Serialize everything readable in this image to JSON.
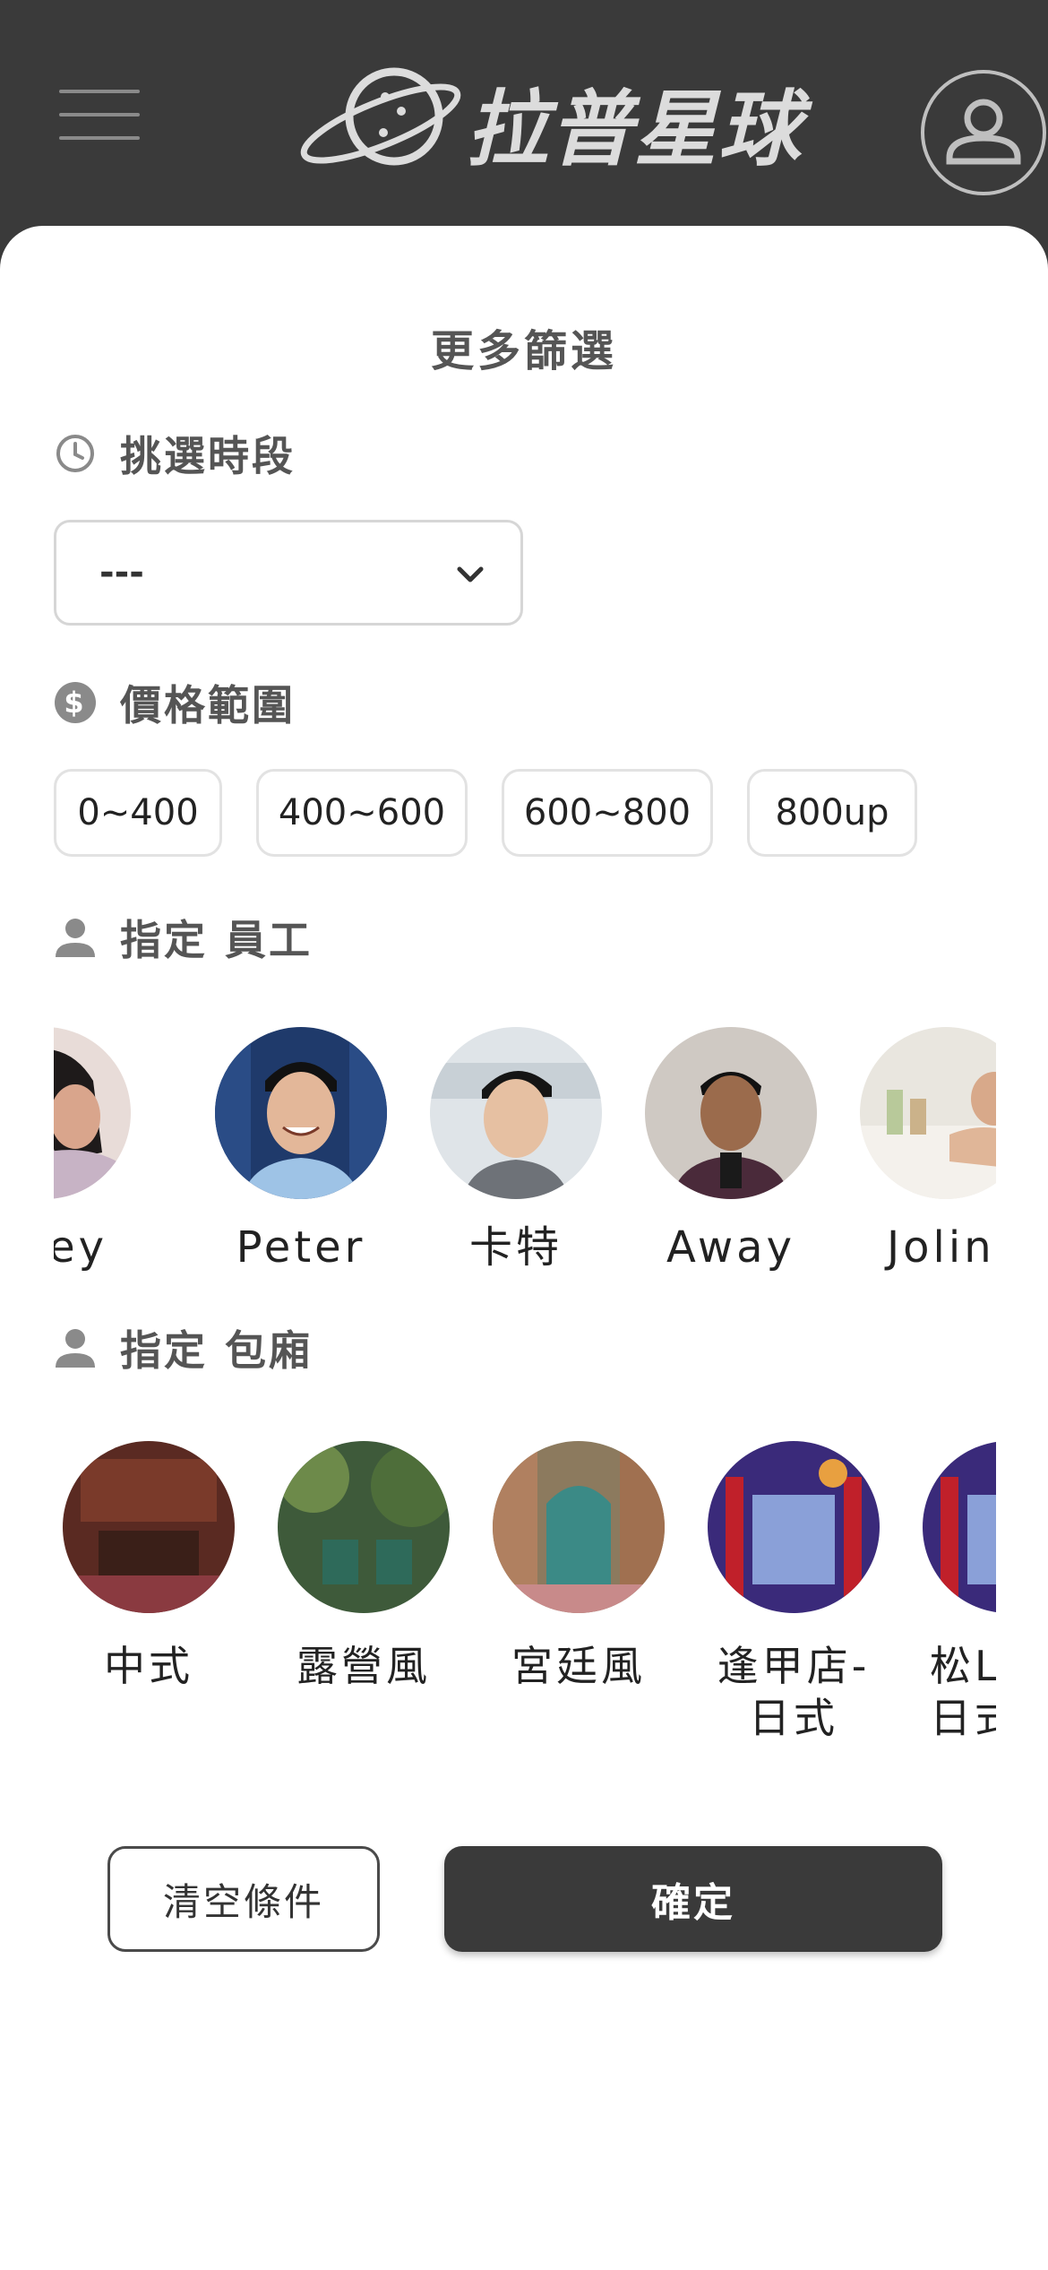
{
  "header": {
    "logo_text": "拉普星球",
    "menu_icon": "hamburger-icon",
    "account_icon": "user-circle-icon"
  },
  "filter": {
    "title": "更多篩選",
    "time_section": {
      "label": "挑選時段",
      "icon": "clock-icon",
      "selected": "---"
    },
    "price_section": {
      "label": "價格範圍",
      "icon": "dollar-circle-icon",
      "options": [
        "0~400",
        "400~600",
        "600~800",
        "800up"
      ]
    },
    "staff_section": {
      "label": "指定 員工",
      "icon": "person-icon",
      "people": [
        "aley",
        "Peter",
        "卡特",
        "Away",
        "Jolin"
      ]
    },
    "room_section": {
      "label": "指定 包廂",
      "icon": "person-icon",
      "rooms": [
        {
          "line1": "中式",
          "line2": ""
        },
        {
          "line1": "露營風",
          "line2": ""
        },
        {
          "line1": "宮廷風",
          "line2": ""
        },
        {
          "line1": "逢甲店-",
          "line2": "日式"
        },
        {
          "line1": "松L",
          "line2": "日式"
        }
      ]
    },
    "clear_label": "清空條件",
    "confirm_label": "確定"
  },
  "colors": {
    "header_bg": "#3a3a3a",
    "primary_button": "#3a3a3a",
    "text_label": "#555555"
  }
}
